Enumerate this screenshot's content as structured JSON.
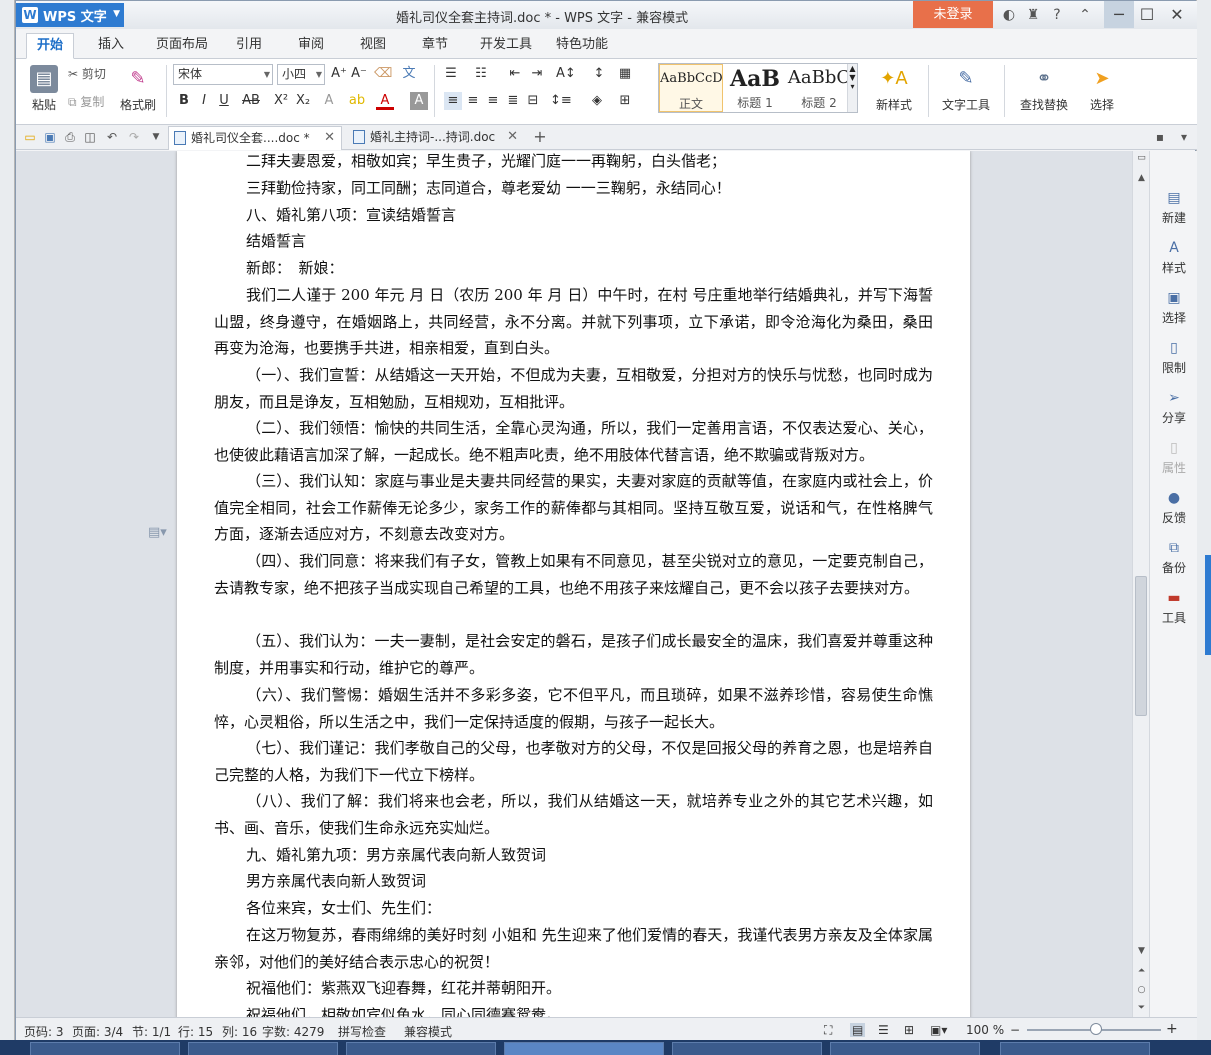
{
  "titlebar": {
    "app_name": "WPS 文字",
    "doc_title": "婚礼司仪全套主持词.doc * - WPS 文字 - 兼容模式",
    "login": "未登录"
  },
  "tabs": [
    "开始",
    "插入",
    "页面布局",
    "引用",
    "审阅",
    "视图",
    "章节",
    "开发工具",
    "特色功能"
  ],
  "ribbon": {
    "paste": "粘贴",
    "cut": "剪切",
    "copy": "复制",
    "format_painter": "格式刷",
    "font_name": "宋体",
    "font_size": "小四",
    "styles": [
      {
        "sample": "AaBbCcD",
        "label": "正文"
      },
      {
        "sample": "AaB",
        "label": "标题 1"
      },
      {
        "sample": "AaBbC",
        "label": "标题 2"
      }
    ],
    "new_style": "新样式",
    "text_tools": "文字工具",
    "find_replace": "查找替换",
    "select": "选择"
  },
  "doc_tabs": [
    {
      "label": "婚礼司仪全套....doc *",
      "active": true
    },
    {
      "label": "婚礼主持词-...持词.doc",
      "active": false
    }
  ],
  "document": {
    "paragraphs": [
      "二拜夫妻恩爱，相敬如宾；早生贵子，光耀门庭一一再鞠躬，白头偕老；",
      "三拜勤俭持家，同工同酬；志同道合，尊老爱幼 一一三鞠躬，永结同心！",
      "八、婚礼第八项：宣读结婚誓言",
      "结婚誓言",
      "新郎：　新娘：",
      "我们二人谨于 200 年元 月 日（农历 200 年 月 日）中午时，在村 号庄重地举行结婚典礼，并写下海誓山盟，终身遵守，在婚姻路上，共同经营，永不分离。并就下列事项，立下承诺，即令沧海化为桑田，桑田再变为沧海，也要携手共进，相亲相爱，直到白头。",
      "（一）、我们宣誓：从结婚这一天开始，不但成为夫妻，互相敬爱，分担对方的快乐与忧愁，也同时成为朋友，而且是诤友，互相勉励，互相规劝，互相批评。",
      "（二）、我们领悟：愉快的共同生活，全靠心灵沟通，所以，我们一定善用言语，不仅表达爱心、关心，也使彼此藉语言加深了解，一起成长。绝不粗声叱责，绝不用肢体代替言语，绝不欺骗或背叛对方。",
      "（三）、我们认知：家庭与事业是夫妻共同经营的果实，夫妻对家庭的贡献等值，在家庭内或社会上，价值完全相同，社会工作薪俸无论多少，家务工作的薪俸都与其相同。坚持互敬互爱，说话和气，在性格脾气方面，逐渐去适应对方，不刻意去改变对方。",
      "（四）、我们同意：将来我们有子女，管教上如果有不同意见，甚至尖锐对立的意见，一定要克制自己，去请教专家，绝不把孩子当成实现自己希望的工具，也绝不用孩子来炫耀自己，更不会以孩子去要挟对方。",
      "（五）、我们认为：一夫一妻制，是社会安定的磐石，是孩子们成长最安全的温床，我们喜爱并尊重这种制度，并用事实和行动，维护它的尊严。",
      "（六）、我们警惕：婚姻生活并不多彩多姿，它不但平凡，而且琐碎，如果不滋养珍惜，容易使生命憔悴，心灵粗俗，所以生活之中，我们一定保持适度的假期，与孩子一起长大。",
      "（七）、我们谨记：我们孝敬自己的父母，也孝敬对方的父母，不仅是回报父母的养育之恩，也是培养自己完整的人格，为我们下一代立下榜样。",
      "（八）、我们了解：我们将来也会老，所以，我们从结婚这一天，就培养专业之外的其它艺术兴趣，如书、画、音乐，使我们生命永远充实灿烂。",
      "九、婚礼第九项：男方亲属代表向新人致贺词",
      "男方亲属代表向新人致贺词",
      "各位来宾，女士们、先生们：",
      "在这万物复苏，春雨绵绵的美好时刻 小姐和 先生迎来了他们爱情的春天，我谨代表男方亲友及全体家属亲邻，对他们的美好结合表示忠心的祝贺！",
      "祝福他们：紫燕双飞迎春舞，红花并蒂朝阳开。",
      "祝福他们，相敬如宾似鱼水，同心同德赛鸳鸯。"
    ]
  },
  "sidepanel": [
    {
      "label": "新建",
      "icon": "new-doc-icon",
      "enabled": true
    },
    {
      "label": "样式",
      "icon": "style-icon",
      "enabled": true
    },
    {
      "label": "选择",
      "icon": "select-icon",
      "enabled": true
    },
    {
      "label": "限制",
      "icon": "restrict-icon",
      "enabled": true
    },
    {
      "label": "分享",
      "icon": "share-icon",
      "enabled": true
    },
    {
      "label": "属性",
      "icon": "properties-icon",
      "enabled": false
    },
    {
      "label": "反馈",
      "icon": "feedback-icon",
      "enabled": true
    },
    {
      "label": "备份",
      "icon": "backup-icon",
      "enabled": true
    },
    {
      "label": "工具",
      "icon": "toolbox-icon",
      "enabled": true
    }
  ],
  "status": {
    "page_no": "页码: 3",
    "pages": "页面: 3/4",
    "section": "节: 1/1",
    "row": "行: 15",
    "col": "列: 16",
    "words": "字数: 4279",
    "spell": "拼写检查",
    "mode": "兼容模式",
    "zoom": "100 %",
    "zoom_level": 100
  },
  "colors": {
    "accent": "#2e7bd1",
    "login": "#e8704a"
  }
}
